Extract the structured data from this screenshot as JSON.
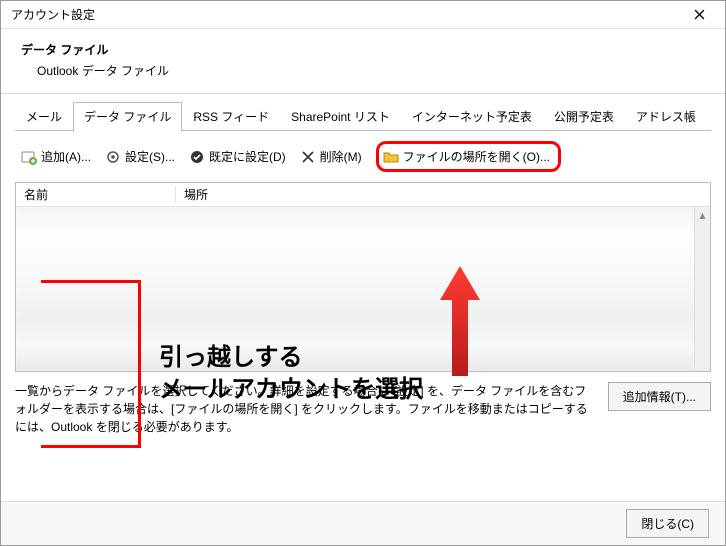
{
  "window": {
    "title": "アカウント設定"
  },
  "header": {
    "title": "データ ファイル",
    "subtitle": "Outlook データ ファイル"
  },
  "tabs": [
    {
      "label": "メール"
    },
    {
      "label": "データ ファイル"
    },
    {
      "label": "RSS フィード"
    },
    {
      "label": "SharePoint リスト"
    },
    {
      "label": "インターネット予定表"
    },
    {
      "label": "公開予定表"
    },
    {
      "label": "アドレス帳"
    }
  ],
  "toolbar": {
    "add": "追加(A)...",
    "settings": "設定(S)...",
    "default": "既定に設定(D)",
    "remove": "削除(M)",
    "open_location": "ファイルの場所を開く(O)..."
  },
  "columns": {
    "name": "名前",
    "path": "場所"
  },
  "annotation": {
    "line1": "引っ越しする",
    "line2": "メールアカウントを選択"
  },
  "help_text": "一覧からデータ ファイルを選択してください。詳細を設定する場合は [設定] を、データ ファイルを含むフォルダーを表示する場合は、[ファイルの場所を開く] をクリックします。ファイルを移動またはコピーするには、Outlook を閉じる必要があります。",
  "buttons": {
    "more_info": "追加情報(T)...",
    "close": "閉じる(C)"
  }
}
